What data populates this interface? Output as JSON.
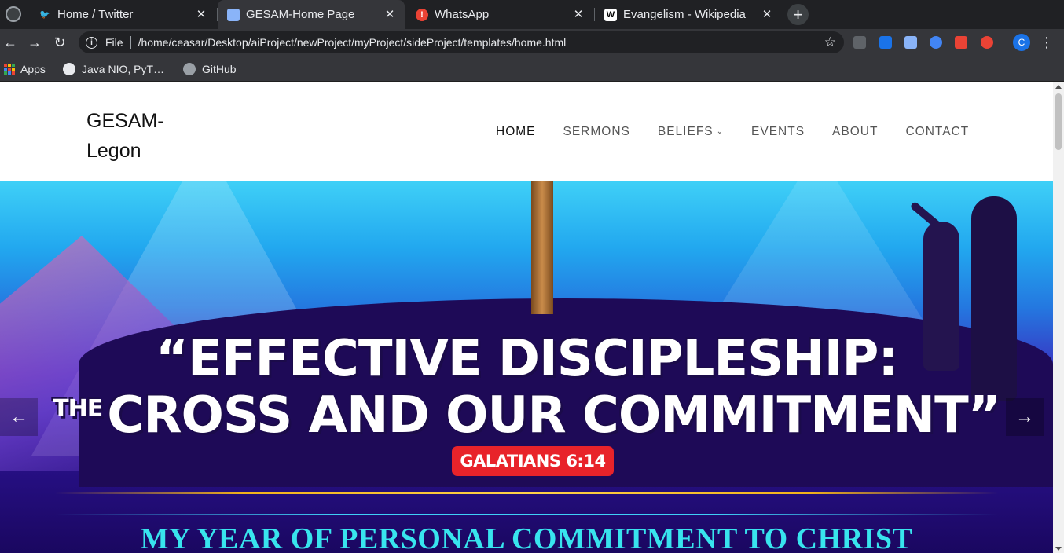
{
  "browser": {
    "tabs": [
      {
        "title": "Home / Twitter",
        "favicon": "twitter-icon",
        "color": "#1da1f2",
        "active": false
      },
      {
        "title": "GESAM-Home Page",
        "favicon": "page-icon",
        "color": "#8ab4f8",
        "active": true
      },
      {
        "title": "WhatsApp",
        "favicon": "whatsapp-icon",
        "color": "#ea4335",
        "active": false
      },
      {
        "title": "Evangelism - Wikipedia",
        "favicon": "wikipedia-icon",
        "color": "#ffffff",
        "active": false
      }
    ],
    "omnibox": {
      "scheme_label": "File",
      "url": "/home/ceasar/Desktop/aiProject/newProject/myProject/sideProject/templates/home.html"
    },
    "profile_initial": "C",
    "bookmarks": [
      {
        "label": "Apps",
        "icon": "apps-grid-icon"
      },
      {
        "label": "Java NIO, PyT…",
        "icon": "globe-icon"
      },
      {
        "label": "GitHub",
        "icon": "github-icon"
      }
    ]
  },
  "site": {
    "brand_line1": "GESAM-",
    "brand_line2": "Legon",
    "nav": [
      {
        "label": "HOME",
        "active": true
      },
      {
        "label": "SERMONS",
        "active": false
      },
      {
        "label": "BELIEFS",
        "active": false,
        "has_dropdown": true
      },
      {
        "label": "EVENTS",
        "active": false
      },
      {
        "label": "ABOUT",
        "active": false
      },
      {
        "label": "CONTACT",
        "active": false
      }
    ],
    "hero": {
      "headline_line1": "“EFFECTIVE DISCIPLESHIP:",
      "headline_line2_prefix": "THE",
      "headline_line2": "CROSS AND OUR COMMITMENT”",
      "verse": "GALATIANS 6:14",
      "subtitle": "MY YEAR OF PERSONAL COMMITMENT TO CHRIST"
    }
  },
  "colors": {
    "browser_bg": "#202124",
    "toolbar_bg": "#35363a",
    "verse_badge": "#e8232a",
    "subtitle": "#38e4ee"
  }
}
